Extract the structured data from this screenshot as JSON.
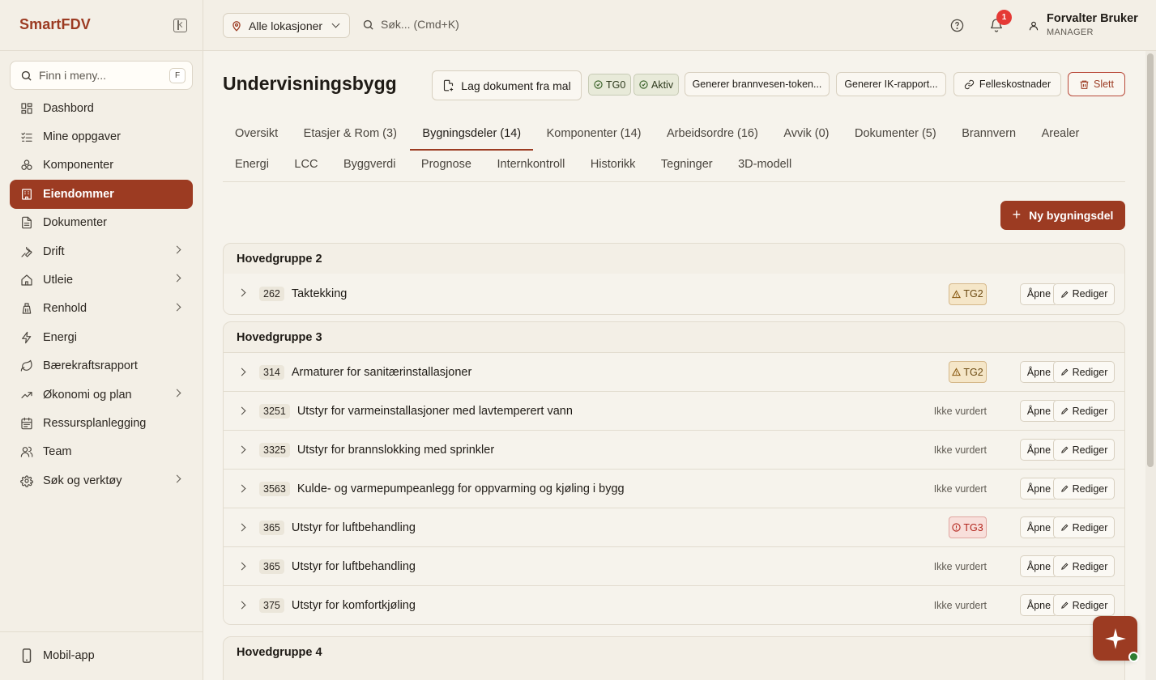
{
  "app": {
    "brand": "SmartFDV"
  },
  "sidebar": {
    "search_placeholder": "Finn i meny...",
    "search_shortcut": "F",
    "items": [
      {
        "label": "Dashbord",
        "icon": "dashboard-icon",
        "has_submenu": false,
        "active": false
      },
      {
        "label": "Mine oppgaver",
        "icon": "tasks-icon",
        "has_submenu": false,
        "active": false
      },
      {
        "label": "Komponenter",
        "icon": "components-icon",
        "has_submenu": false,
        "active": false
      },
      {
        "label": "Eiendommer",
        "icon": "building-icon",
        "has_submenu": false,
        "active": true
      },
      {
        "label": "Dokumenter",
        "icon": "document-icon",
        "has_submenu": false,
        "active": false
      },
      {
        "label": "Drift",
        "icon": "wrench-icon",
        "has_submenu": true,
        "active": false
      },
      {
        "label": "Utleie",
        "icon": "home-icon",
        "has_submenu": true,
        "active": false
      },
      {
        "label": "Renhold",
        "icon": "cleaning-icon",
        "has_submenu": true,
        "active": false
      },
      {
        "label": "Energi",
        "icon": "lightning-icon",
        "has_submenu": false,
        "active": false
      },
      {
        "label": "Bærekraftsrapport",
        "icon": "leaf-icon",
        "has_submenu": false,
        "active": false
      },
      {
        "label": "Økonomi og plan",
        "icon": "trend-icon",
        "has_submenu": true,
        "active": false
      },
      {
        "label": "Ressursplanlegging",
        "icon": "calendar-icon",
        "has_submenu": false,
        "active": false
      },
      {
        "label": "Team",
        "icon": "users-icon",
        "has_submenu": false,
        "active": false
      },
      {
        "label": "Søk og verktøy",
        "icon": "gear-icon",
        "has_submenu": true,
        "active": false
      }
    ],
    "mobile_app": "Mobil-app"
  },
  "header": {
    "location": "Alle lokasjoner",
    "search_placeholder": "Søk... (Cmd+K)",
    "notifications_count": "1",
    "user_name": "Forvalter Bruker",
    "user_role": "MANAGER"
  },
  "page": {
    "title": "Undervisningsbygg",
    "actions": {
      "create_doc": "Lag dokument fra mal",
      "tag_tg": "TG0",
      "tag_status": "Aktiv",
      "fire_token": "Generer brannvesen-token...",
      "ik_report": "Generer IK-rapport...",
      "shared_costs": "Felleskostnader",
      "delete": "Slett"
    },
    "tabs_row1": [
      {
        "label": "Oversikt",
        "active": false
      },
      {
        "label": "Etasjer & Rom (3)",
        "active": false
      },
      {
        "label": "Bygningsdeler (14)",
        "active": true
      },
      {
        "label": "Komponenter (14)",
        "active": false
      },
      {
        "label": "Arbeidsordre (16)",
        "active": false
      },
      {
        "label": "Avvik (0)",
        "active": false
      },
      {
        "label": "Dokumenter (5)",
        "active": false
      },
      {
        "label": "Brannvern",
        "active": false
      },
      {
        "label": "Arealer",
        "active": false
      }
    ],
    "tabs_row2": [
      {
        "label": "Energi"
      },
      {
        "label": "LCC"
      },
      {
        "label": "Byggverdi"
      },
      {
        "label": "Prognose"
      },
      {
        "label": "Internkontroll"
      },
      {
        "label": "Historikk"
      },
      {
        "label": "Tegninger"
      },
      {
        "label": "3D-modell"
      }
    ],
    "new_button": "Ny bygningsdel",
    "open_label": "Åpne",
    "edit_label": "Rediger",
    "groups": [
      {
        "title": "Hovedgruppe 2",
        "rows": [
          {
            "code": "262",
            "name": "Taktekking",
            "status": "TG2"
          }
        ]
      },
      {
        "title": "Hovedgruppe 3",
        "rows": [
          {
            "code": "314",
            "name": "Armaturer for sanitærinstallasjoner",
            "status": "TG2"
          },
          {
            "code": "3251",
            "name": "Utstyr for varmeinstallasjoner med lavtemperert vann",
            "status": "Ikke vurdert"
          },
          {
            "code": "3325",
            "name": "Utstyr for brannslokking med sprinkler",
            "status": "Ikke vurdert"
          },
          {
            "code": "3563",
            "name": "Kulde- og varmepumpeanlegg for oppvarming og kjøling i bygg",
            "status": "Ikke vurdert"
          },
          {
            "code": "365",
            "name": "Utstyr for luftbehandling",
            "status": "TG3"
          },
          {
            "code": "365",
            "name": "Utstyr for luftbehandling",
            "status": "Ikke vurdert"
          },
          {
            "code": "375",
            "name": "Utstyr for komfortkjøling",
            "status": "Ikke vurdert"
          }
        ]
      },
      {
        "title": "Hovedgruppe 4",
        "rows": []
      }
    ]
  },
  "colors": {
    "brand": "#9c3b22",
    "background": "#f6f3ec",
    "tg2_bg": "#f5e6c8",
    "tg3_bg": "#f8dfdb",
    "tag_green_bg": "#e8ead9"
  }
}
